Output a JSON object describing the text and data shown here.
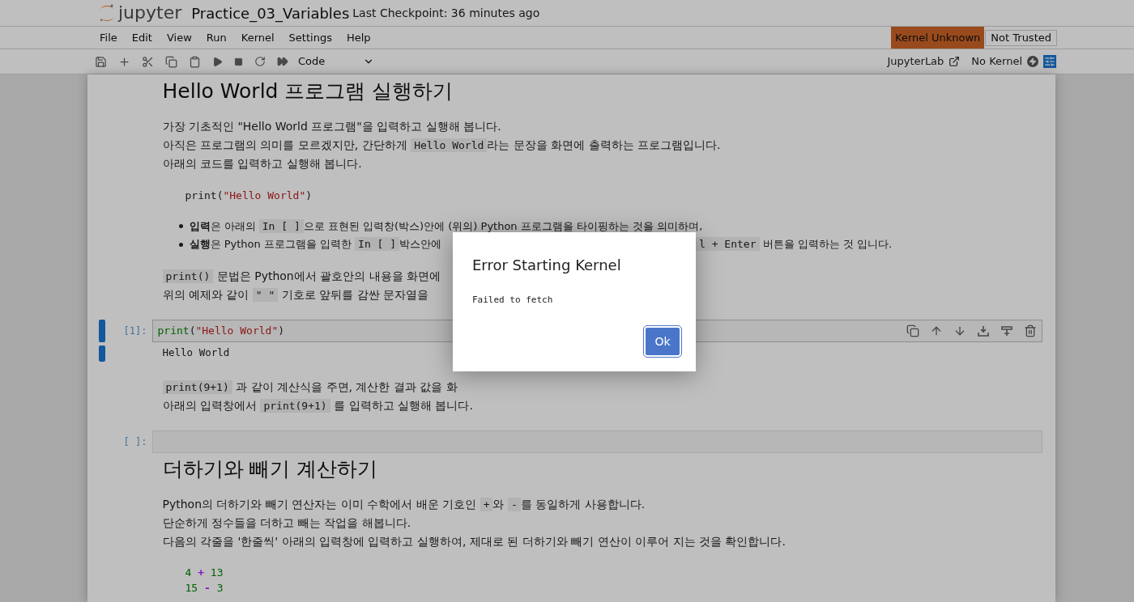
{
  "header": {
    "logo": "jupyter",
    "title": "Practice_03_Variables",
    "checkpoint": "Last Checkpoint: 36 minutes ago"
  },
  "menu": [
    "File",
    "Edit",
    "View",
    "Run",
    "Kernel",
    "Settings",
    "Help"
  ],
  "kernel_status": "Kernel Unknown",
  "trust_status": "Not Trusted",
  "toolbar": {
    "cell_type": "Code",
    "lab_link": "JupyterLab",
    "kernel_name": "No Kernel"
  },
  "blocks": [
    {
      "kind": "heading",
      "text": "Hello World 프로그램 실행하기"
    },
    {
      "kind": "paragraph",
      "lines": [
        [
          {
            "kind": "text",
            "text": "가장 기초적인 \"Hello World 프로그램\"을 입력하고 실행해 봅니다."
          }
        ],
        [
          {
            "kind": "text",
            "text": "아직은 프로그램의 의미를 모르겠지만, 간단하게 "
          },
          {
            "kind": "code",
            "text": "Hello World"
          },
          {
            "kind": "text",
            "text": "라는 문장을 화면에 출력하는 프로그램입니다."
          }
        ],
        [
          {
            "kind": "text",
            "text": "아래의 코드를 입력하고 실행해 봅니다."
          }
        ]
      ]
    },
    {
      "kind": "example",
      "lines": [
        [
          {
            "kind": "plain",
            "text": "print("
          },
          {
            "kind": "string",
            "text": "\"Hello World\""
          },
          {
            "kind": "plain",
            "text": ")"
          }
        ]
      ]
    },
    {
      "kind": "bullets",
      "items": [
        {
          "left": [
            {
              "kind": "text",
              "text": "**입력**은 아래의 "
            },
            {
              "kind": "code",
              "text": "In [ ]"
            },
            {
              "kind": "text",
              "text": "으로 표현된 입력창(박스)안에 (위의) Python 프로그램을 타이핑하는 것을 의미하며,"
            }
          ]
        },
        {
          "left": [
            {
              "kind": "text",
              "text": "**실행**은 Python 프로그램을 입력한 "
            },
            {
              "kind": "code",
              "text": "In [ ]"
            },
            {
              "kind": "text",
              "text": "박스안에"
            }
          ],
          "right": [
            {
              "kind": "code",
              "text": "l + Enter"
            },
            {
              "kind": "text",
              "text": " 버튼을 입력하는 것 입니다."
            }
          ]
        }
      ]
    },
    {
      "kind": "paragraph",
      "lines": [
        [
          {
            "kind": "code",
            "text": "print()"
          },
          {
            "kind": "text",
            "text": " 문법은 Python에서 괄호안의 내용을 화면에"
          }
        ],
        [
          {
            "kind": "text",
            "text": "위의 예제와 같이 "
          },
          {
            "kind": "code",
            "text": "\" \""
          },
          {
            "kind": "text",
            "text": " 기호로 앞뒤를 감싼 문자열을"
          }
        ]
      ]
    },
    {
      "kind": "cell",
      "prompt": "[1]:",
      "selected": true,
      "code": [
        {
          "kind": "builtin",
          "text": "print"
        },
        {
          "kind": "plain",
          "text": "("
        },
        {
          "kind": "string",
          "text": "\"Hello World\""
        },
        {
          "kind": "plain",
          "text": ")"
        }
      ],
      "output": "Hello World"
    },
    {
      "kind": "paragraph",
      "lines": [
        [
          {
            "kind": "code",
            "text": "print(9+1)"
          },
          {
            "kind": "text",
            "text": " 과 같이 계산식을 주면, 계산한 결과 값을 화"
          }
        ],
        [
          {
            "kind": "text",
            "text": "아래의 입력창에서 "
          },
          {
            "kind": "code",
            "text": "print(9+1)"
          },
          {
            "kind": "text",
            "text": " 를 입력하고 실행해 봅니다."
          }
        ]
      ]
    },
    {
      "kind": "cell",
      "prompt": "[ ]:",
      "selected": false
    },
    {
      "kind": "heading",
      "text": "더하기와 빼기 계산하기"
    },
    {
      "kind": "paragraph",
      "lines": [
        [
          {
            "kind": "text",
            "text": "Python의 더하기와 빼기 연산자는 이미 수학에서 배운 기호인 "
          },
          {
            "kind": "code",
            "text": "+"
          },
          {
            "kind": "text",
            "text": "와 "
          },
          {
            "kind": "code",
            "text": "-"
          },
          {
            "kind": "text",
            "text": "를 동일하게 사용합니다."
          }
        ],
        [
          {
            "kind": "text",
            "text": "단순하게 정수들을 더하고 빼는 작업을 해봅니다."
          }
        ],
        [
          {
            "kind": "text",
            "text": "다음의 각줄을 '한줄씩' 아래의 입력창에 입력하고 실행하여, 제대로 된 더하기와 빼기 연산이 이루어 지는 것을 확인합니다."
          }
        ]
      ]
    },
    {
      "kind": "example",
      "lines": [
        [
          {
            "kind": "number",
            "text": "4"
          },
          {
            "kind": "operator",
            "text": " + "
          },
          {
            "kind": "number",
            "text": "13"
          }
        ],
        [
          {
            "kind": "number",
            "text": "15"
          },
          {
            "kind": "operator",
            "text": " - "
          },
          {
            "kind": "number",
            "text": "3"
          }
        ]
      ]
    }
  ],
  "dialog": {
    "title": "Error Starting Kernel",
    "message": "Failed to fetch",
    "button": "Ok"
  }
}
